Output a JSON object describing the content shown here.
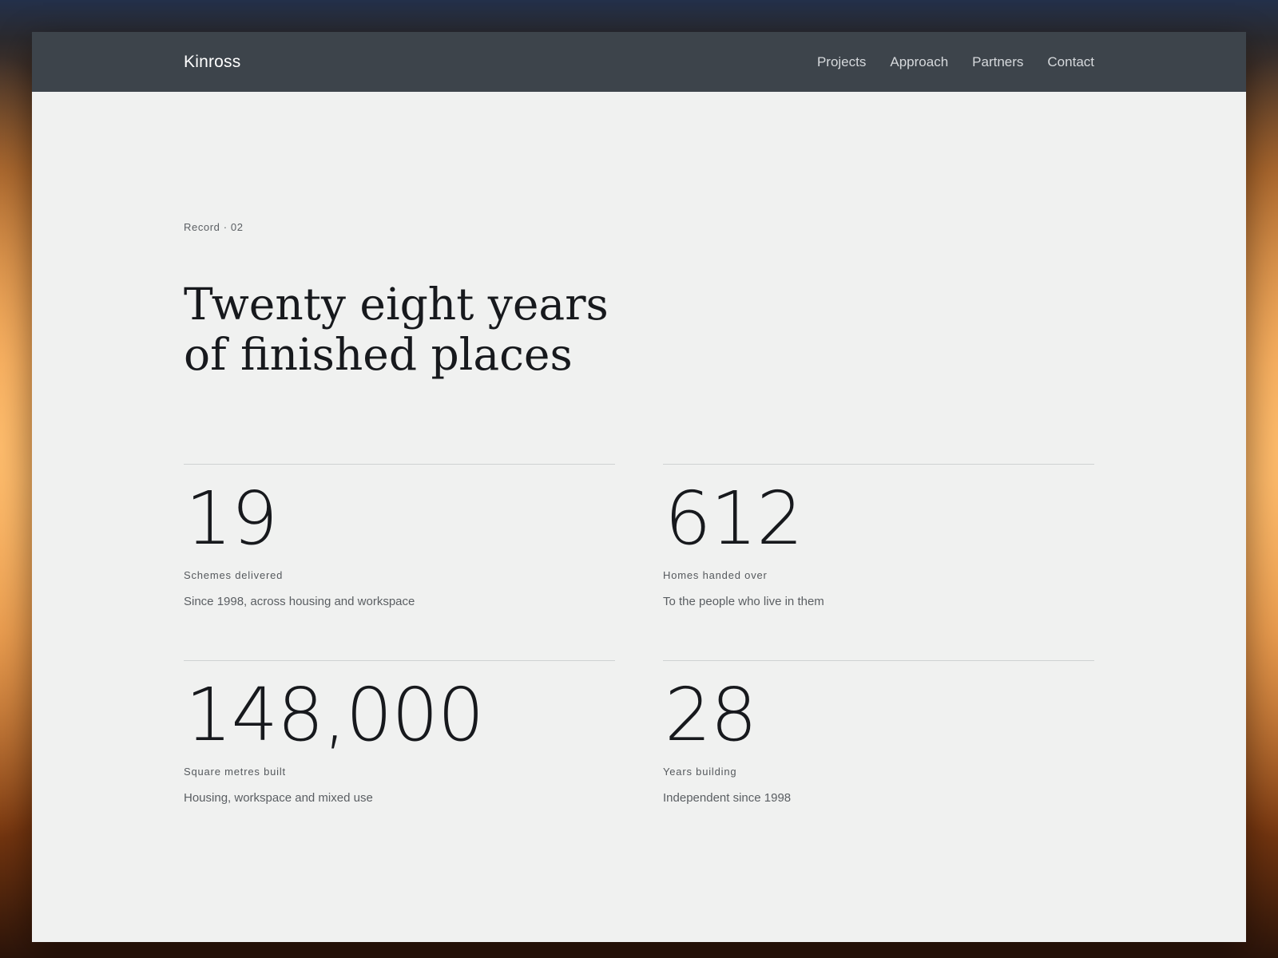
{
  "header": {
    "brand": "Kinross",
    "nav": [
      {
        "label": "Projects"
      },
      {
        "label": "Approach"
      },
      {
        "label": "Partners"
      },
      {
        "label": "Contact"
      }
    ]
  },
  "hero": {
    "eyebrow": "Record · 02",
    "title_line1": "Twenty eight years",
    "title_line2": "of finished places"
  },
  "stats": [
    {
      "value": "19",
      "label": "Schemes delivered",
      "description": "Since 1998, across housing and workspace"
    },
    {
      "value": "612",
      "label": "Homes handed over",
      "description": "To the people who live in them"
    },
    {
      "value": "148,000",
      "label": "Square metres built",
      "description": "Housing, workspace and mixed use"
    },
    {
      "value": "28",
      "label": "Years building",
      "description": "Independent since 1998"
    }
  ],
  "colors": {
    "topbar": "#3d444b",
    "page": "#f0f1f0",
    "ink": "#17191d",
    "muted": "#5a5e62",
    "rule": "#cfd2d2"
  }
}
